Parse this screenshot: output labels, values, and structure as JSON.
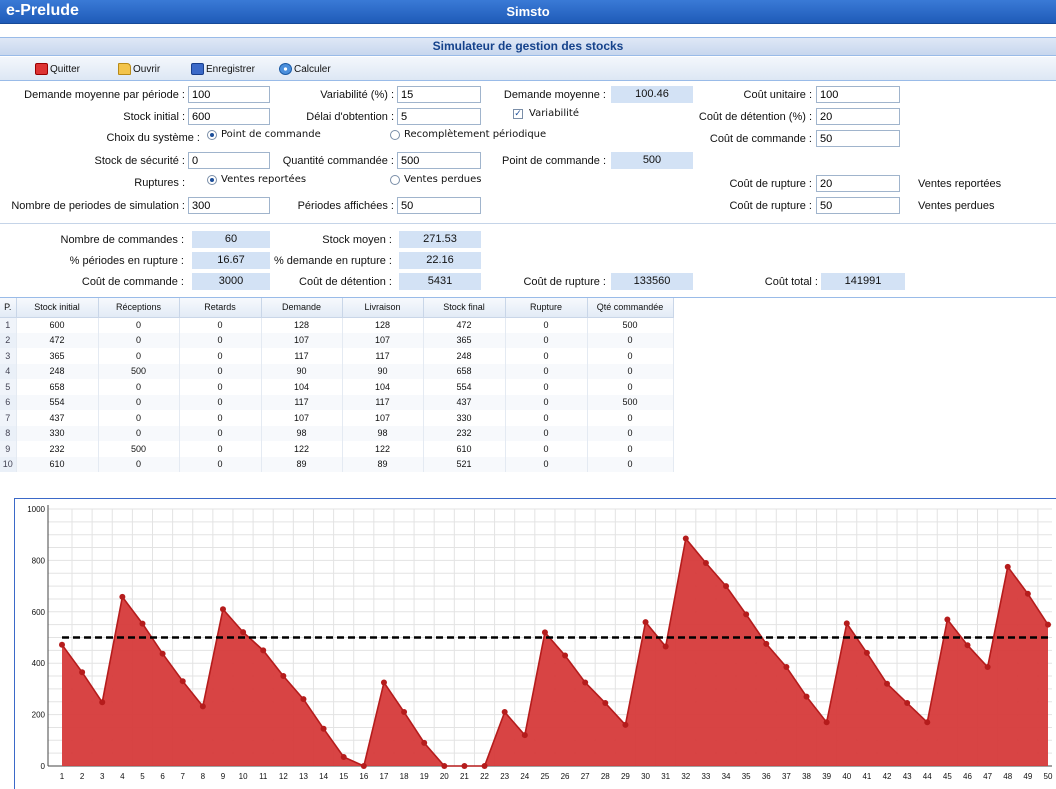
{
  "brand": "e-Prelude",
  "app_title": "Simsto",
  "subtitle": "Simulateur de gestion des stocks",
  "toolbar": {
    "quit": "Quitter",
    "open": "Ouvrir",
    "save": "Enregistrer",
    "calc": "Calculer"
  },
  "form": {
    "demande_label": "Demande moyenne par période :",
    "demande_value": "100",
    "stock_initial_label": "Stock initial :",
    "stock_initial_value": "600",
    "choix_label": "Choix du système :",
    "radio_point": "Point de commande",
    "radio_recomp": "Recomplètement périodique",
    "stock_secu_label": "Stock de sécurité :",
    "stock_secu_value": "0",
    "ruptures_label": "Ruptures :",
    "radio_reportees": "Ventes reportées",
    "radio_perdues": "Ventes perdues",
    "nb_periodes_label": "Nombre de periodes de simulation :",
    "nb_periodes_value": "300",
    "variabilite_label": "Variabilité (%) :",
    "variabilite_value": "15",
    "delai_label": "Délai d'obtention :",
    "delai_value": "5",
    "qte_label": "Quantité commandée :",
    "qte_value": "500",
    "periodes_aff_label": "Périodes affichées :",
    "periodes_aff_value": "50",
    "dem_moy_label": "Demande moyenne :",
    "dem_moy_value": "100.46",
    "variabilite_chk": "Variabilité",
    "point_cmd_label": "Point de commande :",
    "point_cmd_value": "500",
    "cout_unit_label": "Coût unitaire :",
    "cout_unit_value": "100",
    "cout_det_label": "Coût de détention (%) :",
    "cout_det_value": "20",
    "cout_cmd_label": "Coût de commande :",
    "cout_cmd_value": "50",
    "cout_rupt1_label": "Coût de rupture :",
    "cout_rupt1_value": "20",
    "cout_rupt1_note": "Ventes reportées",
    "cout_rupt2_label": "Coût de rupture :",
    "cout_rupt2_value": "50",
    "cout_rupt2_note": "Ventes perdues"
  },
  "results": {
    "nb_cmd_label": "Nombre de commandes :",
    "nb_cmd_value": "60",
    "pct_per_label": "% périodes en rupture :",
    "pct_per_value": "16.67",
    "cout_cmd_label": "Coût de commande :",
    "cout_cmd_value": "3000",
    "stock_moy_label": "Stock moyen :",
    "stock_moy_value": "271.53",
    "pct_dem_label": "% demande en rupture :",
    "pct_dem_value": "22.16",
    "cout_det_label": "Coût de détention :",
    "cout_det_value": "5431",
    "cout_rupt_label": "Coût de rupture :",
    "cout_rupt_value": "133560",
    "cout_total_label": "Coût total :",
    "cout_total_value": "141991"
  },
  "table": {
    "headers": [
      "P.",
      "Stock initial",
      "Réceptions",
      "Retards",
      "Demande",
      "Livraison",
      "Stock final",
      "Rupture",
      "Qté commandée"
    ],
    "rows": [
      [
        "1",
        "600",
        "0",
        "0",
        "128",
        "128",
        "472",
        "0",
        "500"
      ],
      [
        "2",
        "472",
        "0",
        "0",
        "107",
        "107",
        "365",
        "0",
        "0"
      ],
      [
        "3",
        "365",
        "0",
        "0",
        "117",
        "117",
        "248",
        "0",
        "0"
      ],
      [
        "4",
        "248",
        "500",
        "0",
        "90",
        "90",
        "658",
        "0",
        "0"
      ],
      [
        "5",
        "658",
        "0",
        "0",
        "104",
        "104",
        "554",
        "0",
        "0"
      ],
      [
        "6",
        "554",
        "0",
        "0",
        "117",
        "117",
        "437",
        "0",
        "500"
      ],
      [
        "7",
        "437",
        "0",
        "0",
        "107",
        "107",
        "330",
        "0",
        "0"
      ],
      [
        "8",
        "330",
        "0",
        "0",
        "98",
        "98",
        "232",
        "0",
        "0"
      ],
      [
        "9",
        "232",
        "500",
        "0",
        "122",
        "122",
        "610",
        "0",
        "0"
      ],
      [
        "10",
        "610",
        "0",
        "0",
        "89",
        "89",
        "521",
        "0",
        "0"
      ]
    ]
  },
  "chart_data": {
    "type": "area",
    "x": [
      1,
      2,
      3,
      4,
      5,
      6,
      7,
      8,
      9,
      10,
      11,
      12,
      13,
      14,
      15,
      16,
      17,
      18,
      19,
      20,
      21,
      22,
      23,
      24,
      25,
      26,
      27,
      28,
      29,
      30,
      31,
      32,
      33,
      34,
      35,
      36,
      37,
      38,
      39,
      40,
      41,
      42,
      43,
      44,
      45,
      46,
      47,
      48,
      49,
      50
    ],
    "series": [
      {
        "values": [
          472,
          365,
          248,
          658,
          554,
          437,
          330,
          232,
          610,
          521,
          450,
          350,
          260,
          145,
          35,
          0,
          325,
          210,
          90,
          0,
          0,
          0,
          210,
          120,
          520,
          430,
          325,
          245,
          160,
          560,
          465,
          885,
          790,
          700,
          590,
          475,
          385,
          270,
          170,
          555,
          440,
          320,
          245,
          170,
          570,
          470,
          385,
          775,
          670,
          550
        ]
      }
    ],
    "reference_line": 500,
    "ylim": [
      0,
      1000
    ],
    "yticks": [
      0,
      200,
      400,
      600,
      800,
      1000
    ],
    "colors": {
      "area": "#d63a3a",
      "line": "#b51c1c",
      "reference": "#000000"
    }
  }
}
